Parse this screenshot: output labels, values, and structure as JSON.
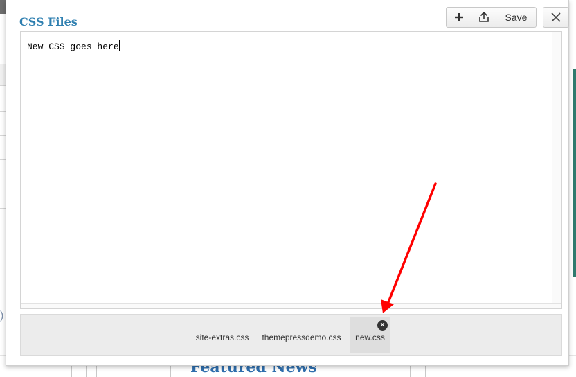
{
  "modal": {
    "title": "CSS Files",
    "toolbar": {
      "save_label": "Save"
    }
  },
  "editor": {
    "content": "New CSS goes here"
  },
  "file_tabs": [
    {
      "label": "site-extras.css",
      "active": false
    },
    {
      "label": "themepressdemo.css",
      "active": false
    },
    {
      "label": "new.css",
      "active": true
    }
  ],
  "background": {
    "heading": "Featured News"
  },
  "colors": {
    "title": "#2e7fb0",
    "arrow": "#ff0000",
    "active_tab": "#dedede"
  },
  "icons": {
    "add": "plus-icon",
    "upload": "upload-icon",
    "close": "close-icon",
    "tab_close": "close-circle-icon"
  }
}
